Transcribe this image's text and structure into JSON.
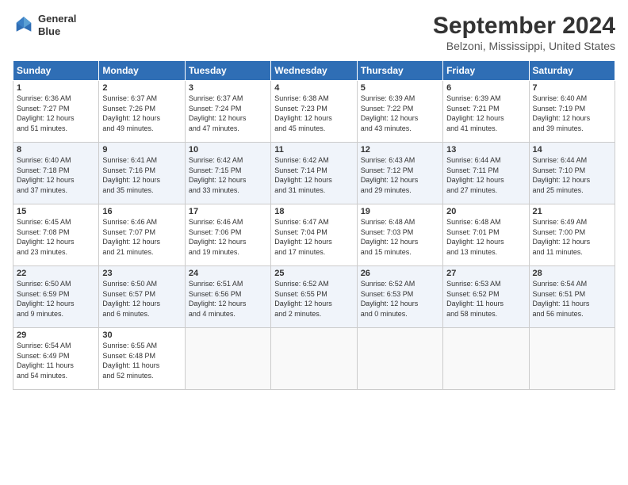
{
  "header": {
    "logo_line1": "General",
    "logo_line2": "Blue",
    "title": "September 2024",
    "subtitle": "Belzoni, Mississippi, United States"
  },
  "weekdays": [
    "Sunday",
    "Monday",
    "Tuesday",
    "Wednesday",
    "Thursday",
    "Friday",
    "Saturday"
  ],
  "weeks": [
    [
      {
        "day": "1",
        "lines": [
          "Sunrise: 6:36 AM",
          "Sunset: 7:27 PM",
          "Daylight: 12 hours",
          "and 51 minutes."
        ]
      },
      {
        "day": "2",
        "lines": [
          "Sunrise: 6:37 AM",
          "Sunset: 7:26 PM",
          "Daylight: 12 hours",
          "and 49 minutes."
        ]
      },
      {
        "day": "3",
        "lines": [
          "Sunrise: 6:37 AM",
          "Sunset: 7:24 PM",
          "Daylight: 12 hours",
          "and 47 minutes."
        ]
      },
      {
        "day": "4",
        "lines": [
          "Sunrise: 6:38 AM",
          "Sunset: 7:23 PM",
          "Daylight: 12 hours",
          "and 45 minutes."
        ]
      },
      {
        "day": "5",
        "lines": [
          "Sunrise: 6:39 AM",
          "Sunset: 7:22 PM",
          "Daylight: 12 hours",
          "and 43 minutes."
        ]
      },
      {
        "day": "6",
        "lines": [
          "Sunrise: 6:39 AM",
          "Sunset: 7:21 PM",
          "Daylight: 12 hours",
          "and 41 minutes."
        ]
      },
      {
        "day": "7",
        "lines": [
          "Sunrise: 6:40 AM",
          "Sunset: 7:19 PM",
          "Daylight: 12 hours",
          "and 39 minutes."
        ]
      }
    ],
    [
      {
        "day": "8",
        "lines": [
          "Sunrise: 6:40 AM",
          "Sunset: 7:18 PM",
          "Daylight: 12 hours",
          "and 37 minutes."
        ]
      },
      {
        "day": "9",
        "lines": [
          "Sunrise: 6:41 AM",
          "Sunset: 7:16 PM",
          "Daylight: 12 hours",
          "and 35 minutes."
        ]
      },
      {
        "day": "10",
        "lines": [
          "Sunrise: 6:42 AM",
          "Sunset: 7:15 PM",
          "Daylight: 12 hours",
          "and 33 minutes."
        ]
      },
      {
        "day": "11",
        "lines": [
          "Sunrise: 6:42 AM",
          "Sunset: 7:14 PM",
          "Daylight: 12 hours",
          "and 31 minutes."
        ]
      },
      {
        "day": "12",
        "lines": [
          "Sunrise: 6:43 AM",
          "Sunset: 7:12 PM",
          "Daylight: 12 hours",
          "and 29 minutes."
        ]
      },
      {
        "day": "13",
        "lines": [
          "Sunrise: 6:44 AM",
          "Sunset: 7:11 PM",
          "Daylight: 12 hours",
          "and 27 minutes."
        ]
      },
      {
        "day": "14",
        "lines": [
          "Sunrise: 6:44 AM",
          "Sunset: 7:10 PM",
          "Daylight: 12 hours",
          "and 25 minutes."
        ]
      }
    ],
    [
      {
        "day": "15",
        "lines": [
          "Sunrise: 6:45 AM",
          "Sunset: 7:08 PM",
          "Daylight: 12 hours",
          "and 23 minutes."
        ]
      },
      {
        "day": "16",
        "lines": [
          "Sunrise: 6:46 AM",
          "Sunset: 7:07 PM",
          "Daylight: 12 hours",
          "and 21 minutes."
        ]
      },
      {
        "day": "17",
        "lines": [
          "Sunrise: 6:46 AM",
          "Sunset: 7:06 PM",
          "Daylight: 12 hours",
          "and 19 minutes."
        ]
      },
      {
        "day": "18",
        "lines": [
          "Sunrise: 6:47 AM",
          "Sunset: 7:04 PM",
          "Daylight: 12 hours",
          "and 17 minutes."
        ]
      },
      {
        "day": "19",
        "lines": [
          "Sunrise: 6:48 AM",
          "Sunset: 7:03 PM",
          "Daylight: 12 hours",
          "and 15 minutes."
        ]
      },
      {
        "day": "20",
        "lines": [
          "Sunrise: 6:48 AM",
          "Sunset: 7:01 PM",
          "Daylight: 12 hours",
          "and 13 minutes."
        ]
      },
      {
        "day": "21",
        "lines": [
          "Sunrise: 6:49 AM",
          "Sunset: 7:00 PM",
          "Daylight: 12 hours",
          "and 11 minutes."
        ]
      }
    ],
    [
      {
        "day": "22",
        "lines": [
          "Sunrise: 6:50 AM",
          "Sunset: 6:59 PM",
          "Daylight: 12 hours",
          "and 9 minutes."
        ]
      },
      {
        "day": "23",
        "lines": [
          "Sunrise: 6:50 AM",
          "Sunset: 6:57 PM",
          "Daylight: 12 hours",
          "and 6 minutes."
        ]
      },
      {
        "day": "24",
        "lines": [
          "Sunrise: 6:51 AM",
          "Sunset: 6:56 PM",
          "Daylight: 12 hours",
          "and 4 minutes."
        ]
      },
      {
        "day": "25",
        "lines": [
          "Sunrise: 6:52 AM",
          "Sunset: 6:55 PM",
          "Daylight: 12 hours",
          "and 2 minutes."
        ]
      },
      {
        "day": "26",
        "lines": [
          "Sunrise: 6:52 AM",
          "Sunset: 6:53 PM",
          "Daylight: 12 hours",
          "and 0 minutes."
        ]
      },
      {
        "day": "27",
        "lines": [
          "Sunrise: 6:53 AM",
          "Sunset: 6:52 PM",
          "Daylight: 11 hours",
          "and 58 minutes."
        ]
      },
      {
        "day": "28",
        "lines": [
          "Sunrise: 6:54 AM",
          "Sunset: 6:51 PM",
          "Daylight: 11 hours",
          "and 56 minutes."
        ]
      }
    ],
    [
      {
        "day": "29",
        "lines": [
          "Sunrise: 6:54 AM",
          "Sunset: 6:49 PM",
          "Daylight: 11 hours",
          "and 54 minutes."
        ]
      },
      {
        "day": "30",
        "lines": [
          "Sunrise: 6:55 AM",
          "Sunset: 6:48 PM",
          "Daylight: 11 hours",
          "and 52 minutes."
        ]
      },
      {
        "day": "",
        "lines": []
      },
      {
        "day": "",
        "lines": []
      },
      {
        "day": "",
        "lines": []
      },
      {
        "day": "",
        "lines": []
      },
      {
        "day": "",
        "lines": []
      }
    ]
  ]
}
